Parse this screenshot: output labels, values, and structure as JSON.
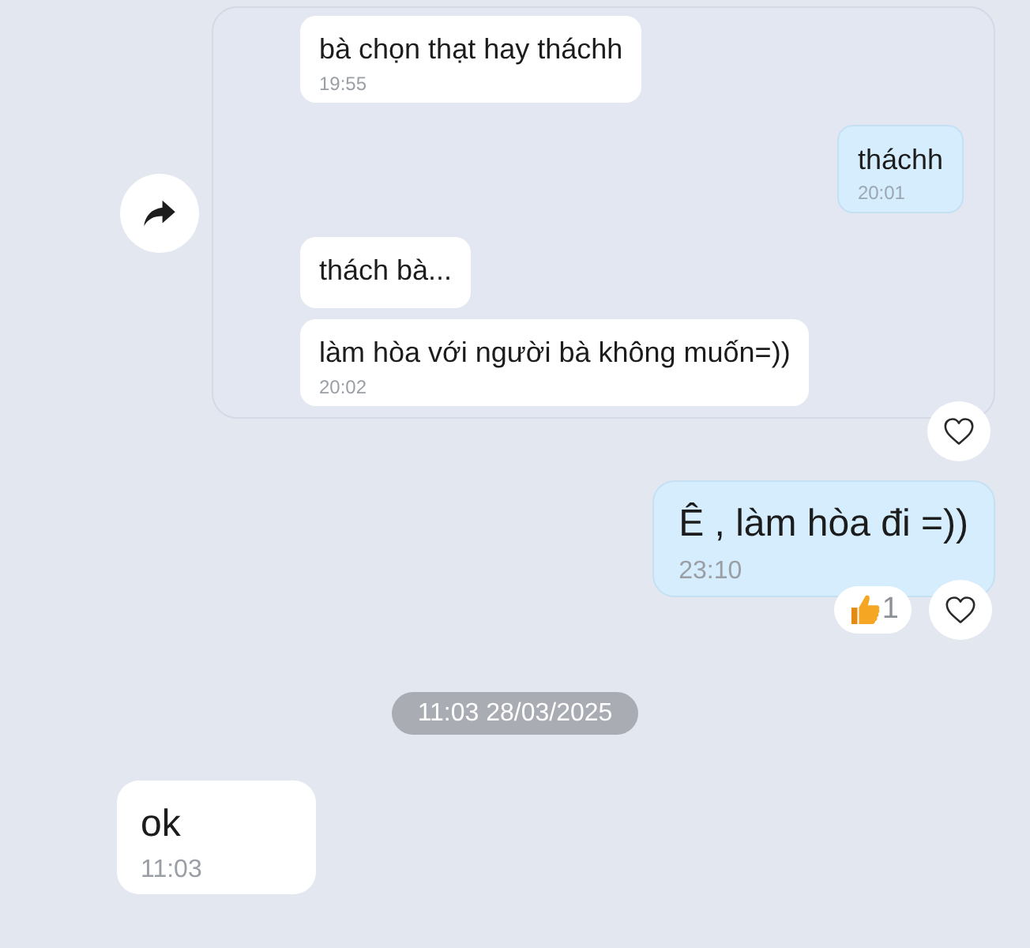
{
  "forwarded_group": {
    "messages": [
      {
        "kind": "incoming",
        "text": "bà chọn thạt hay tháchh",
        "time": "19:55"
      },
      {
        "kind": "outgoing",
        "text": "tháchh",
        "time": "20:01"
      },
      {
        "kind": "incoming",
        "text": "thách bà..."
      },
      {
        "kind": "incoming",
        "text": "làm hòa với người bà không muốn=))",
        "time": "20:02"
      }
    ]
  },
  "messages": [
    {
      "kind": "outgoing",
      "text": "Ê , làm hòa đi =))",
      "time": "23:10",
      "reactions": [
        {
          "count": "1"
        }
      ]
    },
    {
      "kind": "date",
      "text": "11:03 28/03/2025"
    },
    {
      "kind": "incoming",
      "text": "ok",
      "time": "11:03"
    }
  ]
}
